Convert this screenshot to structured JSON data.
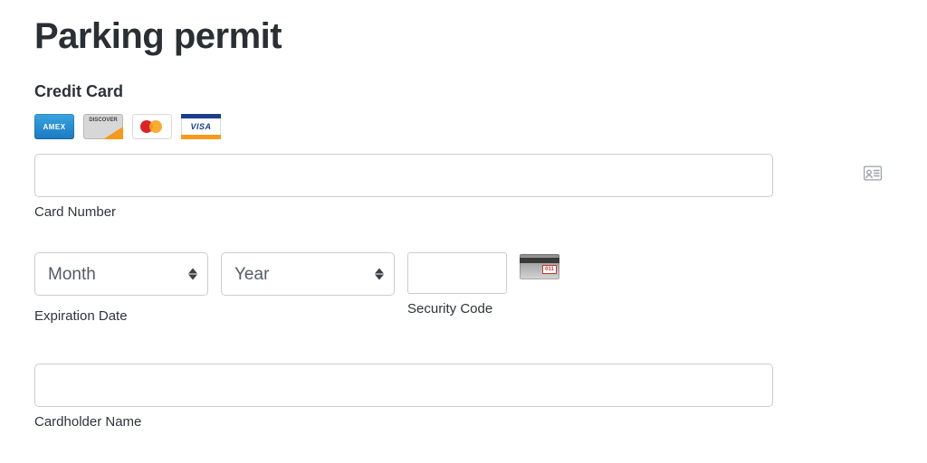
{
  "page": {
    "title": "Parking permit"
  },
  "credit_card": {
    "section_label": "Credit Card",
    "logos": {
      "amex": "AMEX",
      "discover": "DISCOVER",
      "visa": "VISA"
    },
    "card_number": {
      "value": "",
      "label": "Card Number"
    },
    "expiration": {
      "month_placeholder": "Month",
      "year_placeholder": "Year",
      "label": "Expiration Date"
    },
    "cvv": {
      "value": "",
      "label": "Security Code",
      "hint_digits": "011"
    },
    "name": {
      "value": "",
      "label": "Cardholder Name"
    }
  }
}
